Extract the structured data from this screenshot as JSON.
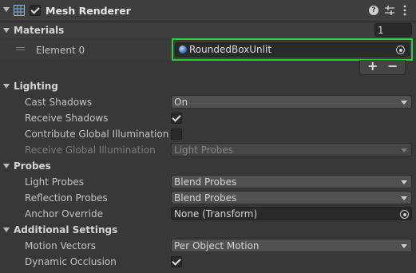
{
  "component": {
    "title": "Mesh Renderer",
    "enabled": true,
    "icons": [
      "mesh-renderer-icon",
      "help-icon",
      "presets-icon",
      "context-menu-icon"
    ]
  },
  "materials": {
    "section_label": "Materials",
    "size": "1",
    "elements": [
      {
        "label": "Element 0",
        "value": "RoundedBoxUnlit"
      }
    ],
    "add_label": "+",
    "remove_label": "−",
    "highlight_color": "#2ecc40"
  },
  "lighting": {
    "section_label": "Lighting",
    "cast_shadows": {
      "label": "Cast Shadows",
      "value": "On"
    },
    "receive_shadows": {
      "label": "Receive Shadows",
      "checked": true
    },
    "contribute_gi": {
      "label": "Contribute Global Illumination",
      "checked": false
    },
    "receive_gi": {
      "label": "Receive Global Illumination",
      "value": "Light Probes",
      "disabled": true
    }
  },
  "probes": {
    "section_label": "Probes",
    "light_probes": {
      "label": "Light Probes",
      "value": "Blend Probes"
    },
    "reflection_probes": {
      "label": "Reflection Probes",
      "value": "Blend Probes"
    },
    "anchor_override": {
      "label": "Anchor Override",
      "value": "None (Transform)"
    }
  },
  "additional": {
    "section_label": "Additional Settings",
    "motion_vectors": {
      "label": "Motion Vectors",
      "value": "Per Object Motion"
    },
    "dynamic_occlusion": {
      "label": "Dynamic Occlusion",
      "checked": true
    }
  }
}
